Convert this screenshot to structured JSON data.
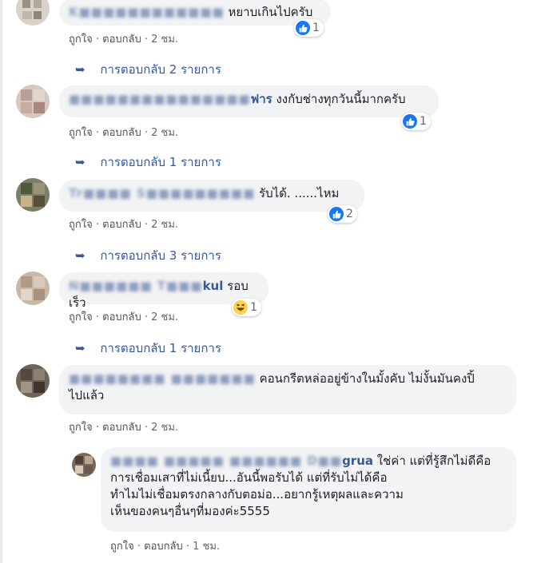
{
  "comments": [
    {
      "name": "K■■■■■■■■■■■■",
      "name_tail": "",
      "text": "หยาบเกินไปครับ",
      "like": "ถูกใจ",
      "reply": "ตอบกลับ",
      "time": "2 ชม.",
      "reaction": "like",
      "reaction_count": "1",
      "replies_label": "การตอบกลับ 2 รายการ"
    },
    {
      "name": "■■■■■■■■■■■■■■■",
      "name_tail": "ฟาร",
      "text": "งงกับช่างทุกวันนี้มากครับ",
      "like": "ถูกใจ",
      "reply": "ตอบกลับ",
      "time": "2 ชม.",
      "reaction": "like",
      "reaction_count": "1",
      "replies_label": "การตอบกลับ 1 รายการ"
    },
    {
      "name": "Tr■■■■ S■■■■■■■■■",
      "name_tail": "",
      "text": "รับได้. ......ไหม",
      "like": "ถูกใจ",
      "reply": "ตอบกลับ",
      "time": "2 ชม.",
      "reaction": "like",
      "reaction_count": "2",
      "replies_label": "การตอบกลับ 3 รายการ"
    },
    {
      "name": "N■■■■■■ T■■■",
      "name_tail": "kul",
      "text": "รอบเร็ว",
      "like": "ถูกใจ",
      "reply": "ตอบกลับ",
      "time": "2 ชม.",
      "reaction": "haha",
      "reaction_count": "1",
      "replies_label": "การตอบกลับ 1 รายการ"
    },
    {
      "name": "■■■■■■■■ ■■■■■■■",
      "name_tail": "",
      "text_line1": "คอนกรีตหล่ออยู่ข้างในมั้งคับ ไม่งั้นมันคงปิ้",
      "text_line2": "ไปแล้ว",
      "like": "ถูกใจ",
      "reply": "ตอบกลับ",
      "time": "2 ชม."
    }
  ],
  "nested_reply": {
    "name": "■■■■ ■■■■■ ■■■■■■ D■■",
    "name_tail": "grua",
    "line1": "ใช่ค่า แต่ที่รู้สึกไม่ดีคือ",
    "line2": "การเชื่อมเสาที่ไม่เนี้ยบ...อันนี้พอรับได้ แต่ที่รับไม่ได้คือ",
    "line3": "ทำไมไม่เชื่อมตรงกลางกับตอม่อ...อยากรู้เหตุผลและความ",
    "line4": "เห็นของคนๆอื่นๆที่มองค่ะ5555",
    "like": "ถูกใจ",
    "reply": "ตอบกลับ",
    "time": "1 ชม."
  },
  "colors": {
    "link": "#385898",
    "bubble": "#f2f3f5",
    "meta": "#606770",
    "like_blue": "#1877f2",
    "haha_yellow": "#fcd34d"
  }
}
